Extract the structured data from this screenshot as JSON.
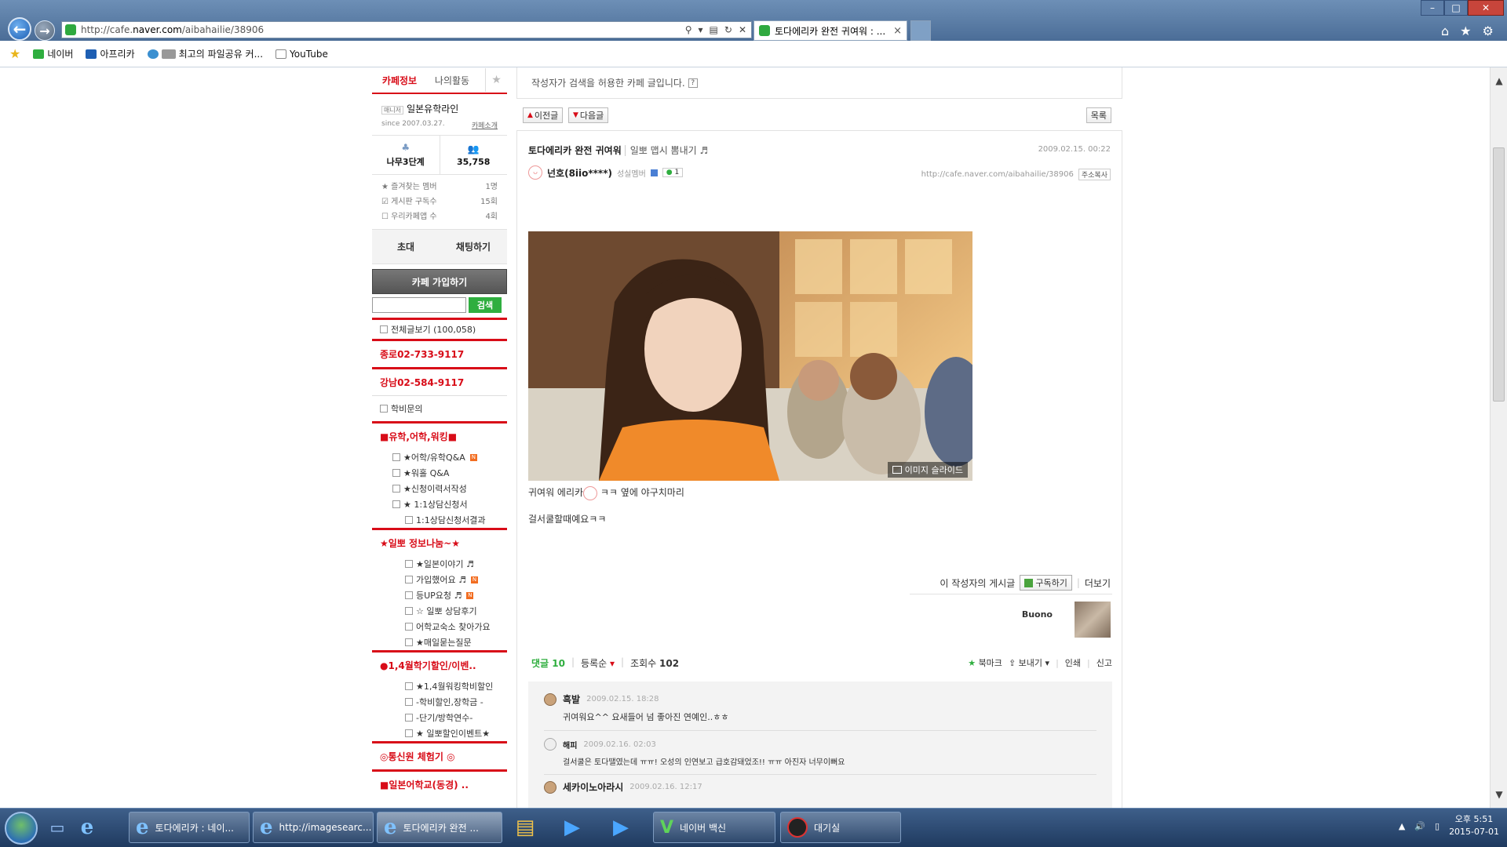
{
  "browser": {
    "url_prefix": "http://cafe.",
    "url_domain": "naver.com",
    "url_path": "/aibahailie/38906",
    "tab_title": "토다에리카 완전 귀여워 : ...",
    "tab_close": "×",
    "favorites": [
      "네이버",
      "아프리카",
      "최고의 파일공유 커...",
      "YouTube"
    ]
  },
  "sidebar": {
    "tab_info": "카페정보",
    "tab_activity": "나의활동",
    "cafe_badge": "매니저",
    "cafe_name": "일본유학라인",
    "since": "since 2007.03.27.",
    "intro_link": "카페소개",
    "level": "나무3단계",
    "members": "35,758",
    "stats": [
      {
        "label": "즐겨찾는 멤버",
        "value": "1명"
      },
      {
        "label": "게시판 구독수",
        "value": "15회"
      },
      {
        "label": "우리카페앱 수",
        "value": "4회"
      }
    ],
    "invite": "초대",
    "chat": "채팅하기",
    "join": "카페 가입하기",
    "search_btn": "검색",
    "all_posts": "전체글보기 (100,058)",
    "phone1": "종로02-733-9117",
    "phone2": "강남02-584-9117",
    "tuition": "학비문의",
    "group1_title": "■유학,어학,워킹■",
    "group1": [
      "★어학/유학Q&A",
      "★워홀 Q&A",
      "★신청이력서작성",
      "★ 1:1상담신청서",
      "1:1상담신청서결과"
    ],
    "group2_title": "★일뽀 정보나눔~★",
    "group2": [
      "★일본이야기 ♬",
      "가입했어요 ♬",
      "등UP요청 ♬",
      "☆ 일뽀 상담후기",
      "어학교숙소 찾아가요",
      "★매일묻는질문"
    ],
    "group3_title": "●1,4월학기할인/이벤..",
    "group3": [
      "★1,4월워킹학비할인",
      "-학비할인,장학금 -",
      "-단기/방학연수-",
      "★ 일뽀할인이벤트★"
    ],
    "group4_title": "◎통신원 체험기 ◎",
    "group5_title": "■일본어학교(동경) .."
  },
  "article": {
    "notice": "작성자가 검색을 허용한 카페 글입니다.",
    "prev": "이전글",
    "next": "다음글",
    "list": "목록",
    "title": "토다에리카 완전 귀여워",
    "category": "일뽀 맵시 뽐내기 ♬",
    "date": "2009.02.15. 00:22",
    "author": "넌호(8iio****)",
    "level": "성실멤버",
    "comment_count_badge": "1",
    "url": "http://cafe.naver.com/aibahailie/38906",
    "copy_url": "주소복사",
    "slideshow": "이미지 슬라이드",
    "body_line1_a": "귀여워 에리카",
    "body_line1_b": "ㅋㅋ 옆에 야구치마리",
    "body_line2": "걸서쿨할때예요ㅋㅋ",
    "author_posts": "이 작성자의 게시글",
    "subscribe": "구독하기",
    "more": "더보기",
    "signature": "Buono",
    "comments_label": "댓글",
    "comments_count": "10",
    "sort": "등록순",
    "views_label": "조회수",
    "views": "102",
    "bookmark": "북마크",
    "share": "보내기",
    "print": "인쇄",
    "report": "신고"
  },
  "comments": [
    {
      "nick": "흑발",
      "date": "2009.02.15. 18:28",
      "text": "귀여워요^^ 요새들어 넘 좋아진 연예인..ㅎㅎ"
    },
    {
      "nick": "해피",
      "date": "2009.02.16. 02:03",
      "text": "걸서쿨은 토다땔였는데 ㅠㅠ! 오성의 인연보고 급호감돼었조!! ㅠㅠ 아진자 너무이뻐요"
    },
    {
      "nick": "세카이노아라시",
      "date": "2009.02.16. 12:17",
      "text": ""
    }
  ],
  "taskbar": {
    "tasks": [
      "토다에리카 : 네이...",
      "http://imagesearc...",
      "토다에리카 완전 ...",
      "네이버 백신",
      "대기실"
    ],
    "time": "오후 5:51",
    "date": "2015-07-01"
  }
}
